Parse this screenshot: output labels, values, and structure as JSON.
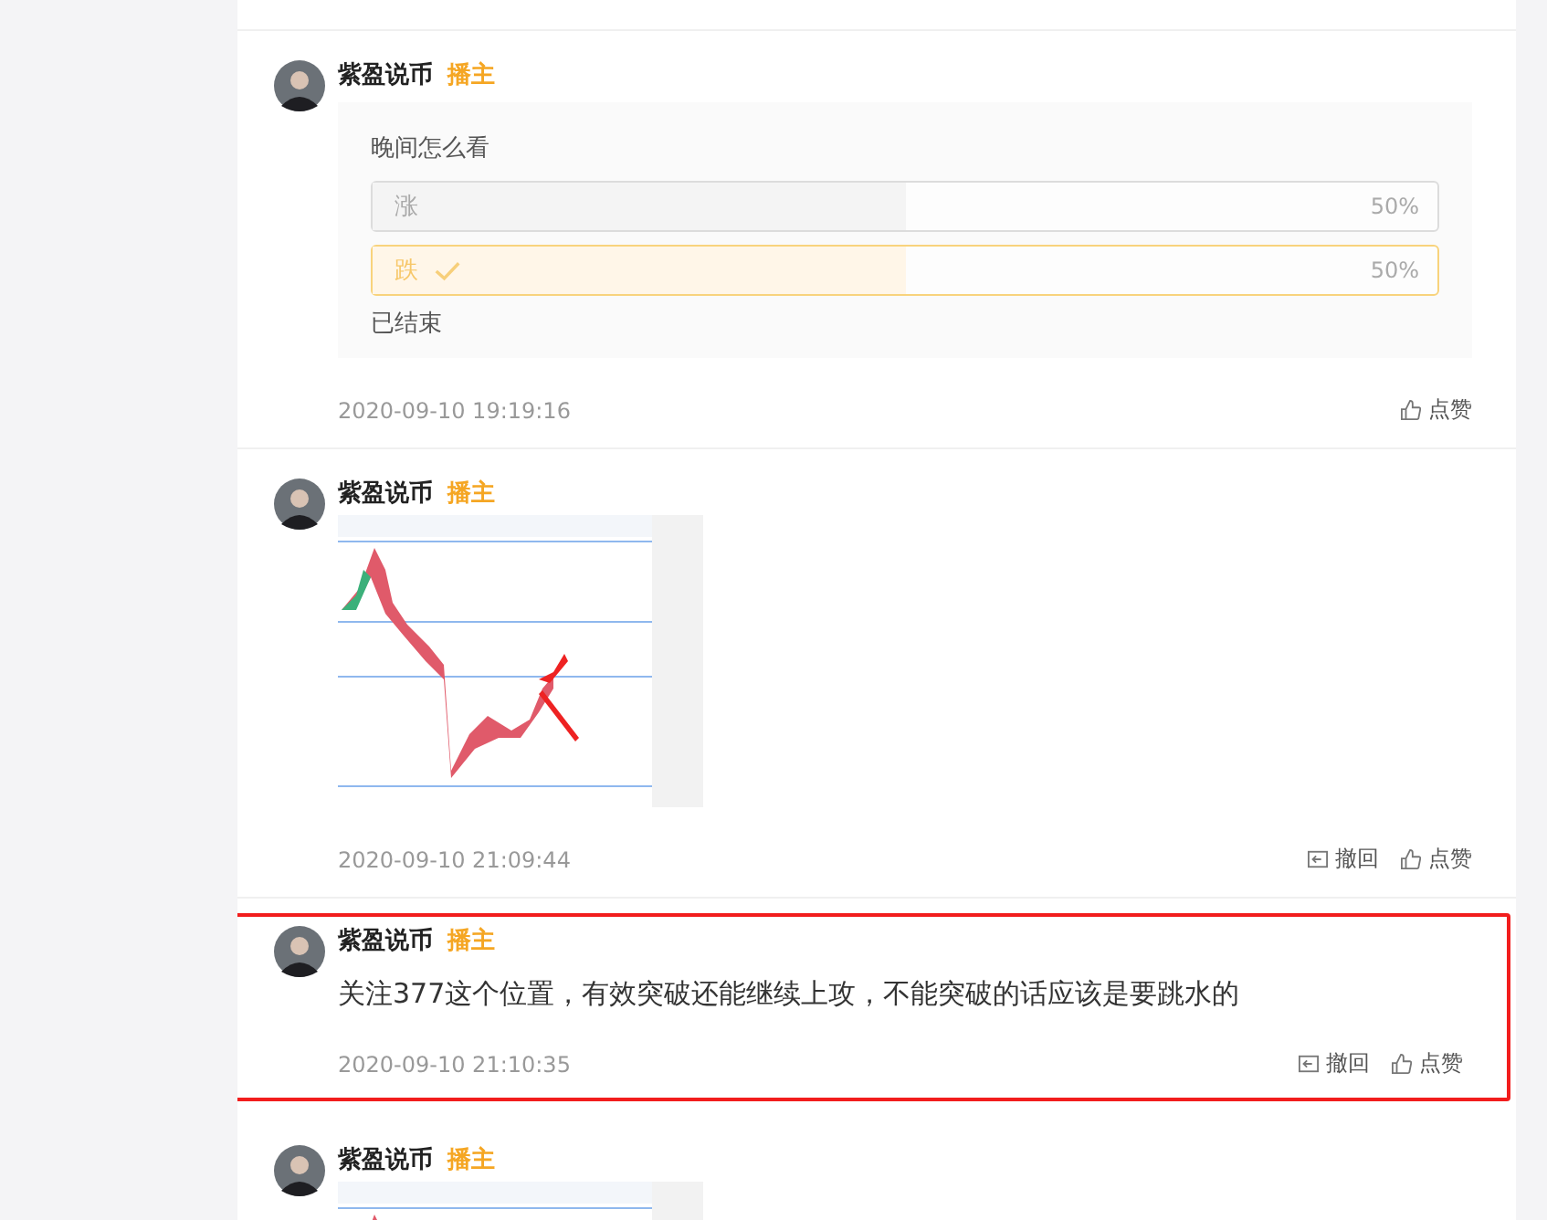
{
  "posts": [
    {
      "author": "紫盈说币",
      "badge": "播主",
      "highlighted": false,
      "kind": "poll",
      "poll": {
        "question": "晚间怎么看",
        "options": [
          {
            "label": "涨",
            "percent": "50%",
            "level": 0.5,
            "selected": false
          },
          {
            "label": "跌",
            "percent": "50%",
            "level": 0.5,
            "selected": true
          }
        ],
        "status": "已结束"
      },
      "time": "2020-09-10 19:19:16",
      "actions": [
        {
          "kind": "like",
          "label": "点赞"
        }
      ]
    },
    {
      "author": "紫盈说币",
      "badge": "播主",
      "highlighted": false,
      "time": "2020-09-10 21:09:44",
      "actions": [
        {
          "kind": "withdraw",
          "label": "撤回"
        },
        {
          "kind": "like",
          "label": "点赞"
        }
      ]
    },
    {
      "author": "紫盈说币",
      "badge": "播主",
      "highlighted": true,
      "kind": "text",
      "text": "关注377这个位置，有效突破还能继续上攻，不能突破的话应该是要跳水的",
      "time": "2020-09-10 21:10:35",
      "actions": [
        {
          "kind": "withdraw",
          "label": "撤回"
        },
        {
          "kind": "like",
          "label": "点赞"
        }
      ]
    },
    {
      "author": "紫盈说币",
      "badge": "播主",
      "highlighted": false
    }
  ]
}
